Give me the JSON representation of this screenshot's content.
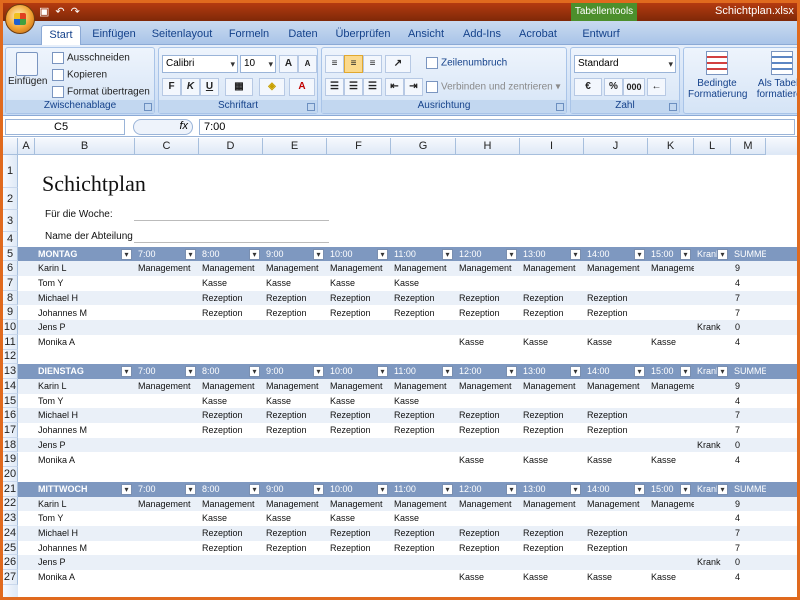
{
  "titlebar": {
    "context_tab": "Tabellentools",
    "doc_title": "Schichtplan.xlsx"
  },
  "tabs": [
    "Start",
    "Einfügen",
    "Seitenlayout",
    "Formeln",
    "Daten",
    "Überprüfen",
    "Ansicht",
    "Add-Ins",
    "Acrobat",
    "Entwurf"
  ],
  "ribbon": {
    "clipboard": {
      "paste": "Einfügen",
      "cut": "Ausschneiden",
      "copy": "Kopieren",
      "format_painter": "Format übertragen",
      "title": "Zwischenablage"
    },
    "font": {
      "family": "Calibri",
      "size": "10",
      "bold": "F",
      "italic": "K",
      "underline": "U",
      "title": "Schriftart"
    },
    "alignment": {
      "wrap": "Zeilenumbruch",
      "merge": "Verbinden und zentrieren",
      "title": "Ausrichtung"
    },
    "number": {
      "format": "Standard",
      "currency": "€",
      "percent": "%",
      "thousands": "000",
      "title": "Zahl"
    },
    "styles": {
      "conditional": "Bedingte Formatierung",
      "as_table": "Als Tabelle formatieren"
    }
  },
  "formula_bar": {
    "name_box": "C5",
    "fx": "fx",
    "value": "7:00"
  },
  "columns": [
    "A",
    "B",
    "C",
    "D",
    "E",
    "F",
    "G",
    "H",
    "I",
    "J",
    "K",
    "L",
    "M"
  ],
  "row_numbers": [
    "1",
    "2",
    "3",
    "4",
    "5",
    "6",
    "7",
    "8",
    "9",
    "10",
    "11",
    "12",
    "13",
    "14",
    "15",
    "16",
    "17",
    "18",
    "19",
    "20",
    "21",
    "22",
    "23",
    "24",
    "25",
    "26",
    "27"
  ],
  "sheet": {
    "title": "Schichtplan",
    "week_label": "Für die Woche:",
    "dept_label": "Name der Abteilung",
    "time_headers": [
      "7:00",
      "8:00",
      "9:00",
      "10:00",
      "11:00",
      "12:00",
      "13:00",
      "14:00",
      "15:00"
    ],
    "sick_header": "Krank?",
    "sum_header": "SUMME",
    "days": [
      {
        "name": "MONTAG",
        "rows": [
          {
            "name": "Karin L",
            "slots": [
              "Management",
              "Management",
              "Management",
              "Management",
              "Management",
              "Management",
              "Management",
              "Management",
              "Management"
            ],
            "sick": "",
            "sum": "9"
          },
          {
            "name": "Tom Y",
            "slots": [
              "",
              "Kasse",
              "Kasse",
              "Kasse",
              "Kasse",
              "",
              "",
              "",
              ""
            ],
            "sick": "",
            "sum": "4"
          },
          {
            "name": "Michael H",
            "slots": [
              "",
              "Rezeption",
              "Rezeption",
              "Rezeption",
              "Rezeption",
              "Rezeption",
              "Rezeption",
              "Rezeption",
              ""
            ],
            "sick": "",
            "sum": "7"
          },
          {
            "name": "Johannes M",
            "slots": [
              "",
              "Rezeption",
              "Rezeption",
              "Rezeption",
              "Rezeption",
              "Rezeption",
              "Rezeption",
              "Rezeption",
              ""
            ],
            "sick": "",
            "sum": "7"
          },
          {
            "name": "Jens P",
            "slots": [
              "",
              "",
              "",
              "",
              "",
              "",
              "",
              "",
              ""
            ],
            "sick": "Krank",
            "sum": "0"
          },
          {
            "name": "Monika A",
            "slots": [
              "",
              "",
              "",
              "",
              "",
              "Kasse",
              "Kasse",
              "Kasse",
              "Kasse"
            ],
            "sick": "",
            "sum": "4"
          }
        ]
      },
      {
        "name": "DIENSTAG",
        "rows": [
          {
            "name": "Karin L",
            "slots": [
              "Management",
              "Management",
              "Management",
              "Management",
              "Management",
              "Management",
              "Management",
              "Management",
              "Management"
            ],
            "sick": "",
            "sum": "9"
          },
          {
            "name": "Tom Y",
            "slots": [
              "",
              "Kasse",
              "Kasse",
              "Kasse",
              "Kasse",
              "",
              "",
              "",
              ""
            ],
            "sick": "",
            "sum": "4"
          },
          {
            "name": "Michael H",
            "slots": [
              "",
              "Rezeption",
              "Rezeption",
              "Rezeption",
              "Rezeption",
              "Rezeption",
              "Rezeption",
              "Rezeption",
              ""
            ],
            "sick": "",
            "sum": "7"
          },
          {
            "name": "Johannes M",
            "slots": [
              "",
              "Rezeption",
              "Rezeption",
              "Rezeption",
              "Rezeption",
              "Rezeption",
              "Rezeption",
              "Rezeption",
              ""
            ],
            "sick": "",
            "sum": "7"
          },
          {
            "name": "Jens P",
            "slots": [
              "",
              "",
              "",
              "",
              "",
              "",
              "",
              "",
              ""
            ],
            "sick": "Krank",
            "sum": "0"
          },
          {
            "name": "Monika A",
            "slots": [
              "",
              "",
              "",
              "",
              "",
              "Kasse",
              "Kasse",
              "Kasse",
              "Kasse"
            ],
            "sick": "",
            "sum": "4"
          }
        ]
      },
      {
        "name": "MITTWOCH",
        "rows": [
          {
            "name": "Karin L",
            "slots": [
              "Management",
              "Management",
              "Management",
              "Management",
              "Management",
              "Management",
              "Management",
              "Management",
              "Management"
            ],
            "sick": "",
            "sum": "9"
          },
          {
            "name": "Tom Y",
            "slots": [
              "",
              "Kasse",
              "Kasse",
              "Kasse",
              "Kasse",
              "",
              "",
              "",
              ""
            ],
            "sick": "",
            "sum": "4"
          },
          {
            "name": "Michael H",
            "slots": [
              "",
              "Rezeption",
              "Rezeption",
              "Rezeption",
              "Rezeption",
              "Rezeption",
              "Rezeption",
              "Rezeption",
              ""
            ],
            "sick": "",
            "sum": "7"
          },
          {
            "name": "Johannes M",
            "slots": [
              "",
              "Rezeption",
              "Rezeption",
              "Rezeption",
              "Rezeption",
              "Rezeption",
              "Rezeption",
              "Rezeption",
              ""
            ],
            "sick": "",
            "sum": "7"
          },
          {
            "name": "Jens P",
            "slots": [
              "",
              "",
              "",
              "",
              "",
              "",
              "",
              "",
              ""
            ],
            "sick": "Krank",
            "sum": "0"
          },
          {
            "name": "Monika A",
            "slots": [
              "",
              "",
              "",
              "",
              "",
              "Kasse",
              "Kasse",
              "Kasse",
              "Kasse"
            ],
            "sick": "",
            "sum": "4"
          }
        ]
      }
    ]
  }
}
